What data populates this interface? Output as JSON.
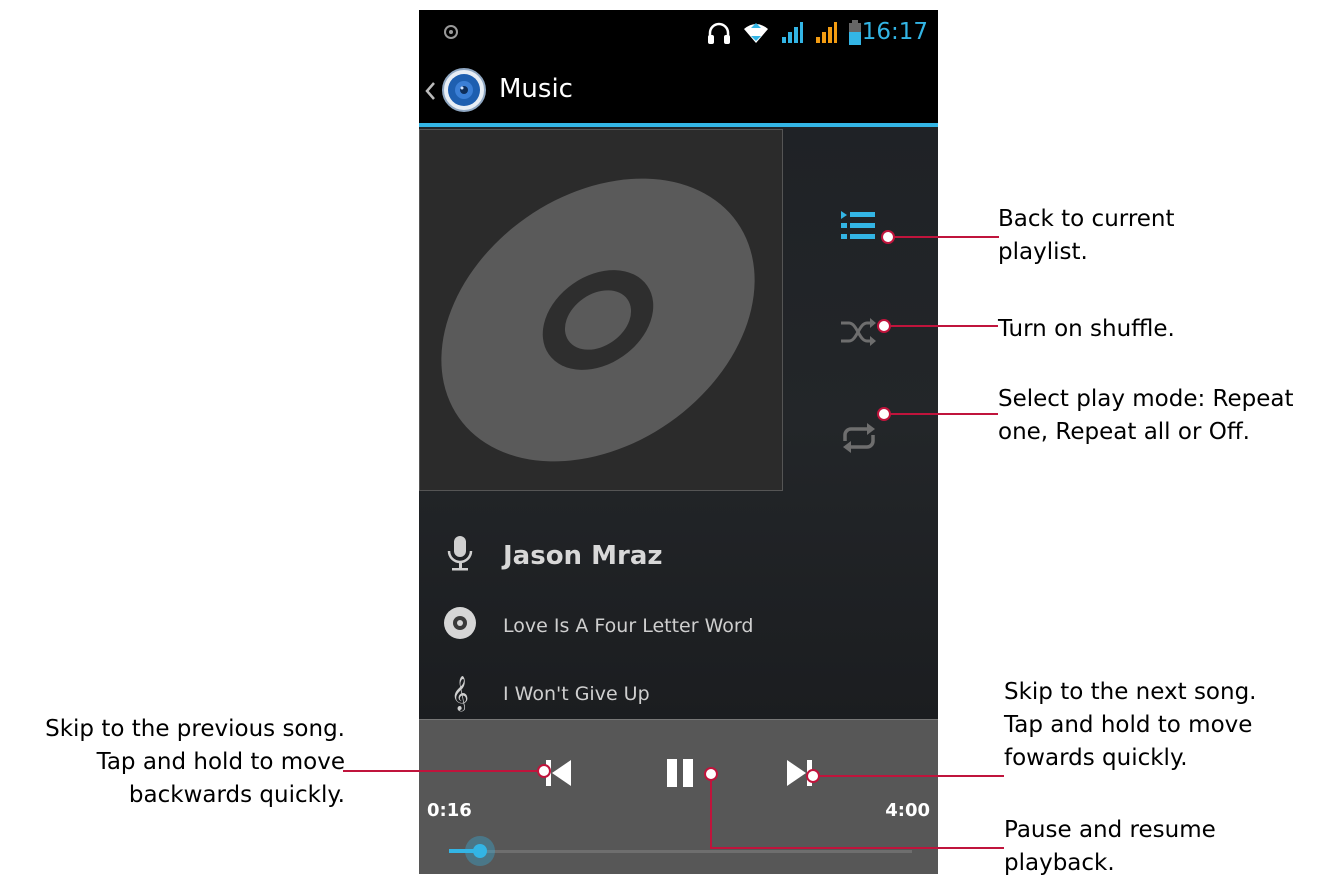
{
  "status_bar": {
    "time": "16:17",
    "icons": [
      "notification-dot-icon",
      "headset-icon",
      "wifi-icon",
      "signal-1-icon",
      "signal-2-icon",
      "battery-icon"
    ]
  },
  "action_bar": {
    "title": "Music",
    "back_icon": "chevron-left-icon",
    "app_icon": "speaker-icon"
  },
  "side_buttons": [
    "playlist-icon",
    "shuffle-icon",
    "repeat-icon"
  ],
  "track": {
    "artist": "Jason Mraz",
    "album": "Love Is A Four Letter Word",
    "song": "I Won't Give Up"
  },
  "playback": {
    "elapsed": "0:16",
    "total": "4:00",
    "progress_fraction": 0.0667,
    "state": "playing"
  },
  "annotations": {
    "playlist": [
      "Back to current",
      "playlist."
    ],
    "shuffle": [
      "Turn on shuffle."
    ],
    "repeat": [
      "Select play mode: Repeat",
      "one, Repeat all or Off."
    ],
    "previous": [
      "Skip to the previous song.",
      "Tap and hold to move",
      "backwards quickly."
    ],
    "next": [
      "Skip to the next song.",
      "Tap and hold to move",
      "fowards quickly."
    ],
    "pause": [
      "Pause and resume",
      "playback."
    ]
  },
  "colors": {
    "accent": "#33b5e5",
    "callout": "#c0143c",
    "control_bar": "#575757",
    "album": "#2b2b2b",
    "disc": "#5a5a5a"
  }
}
